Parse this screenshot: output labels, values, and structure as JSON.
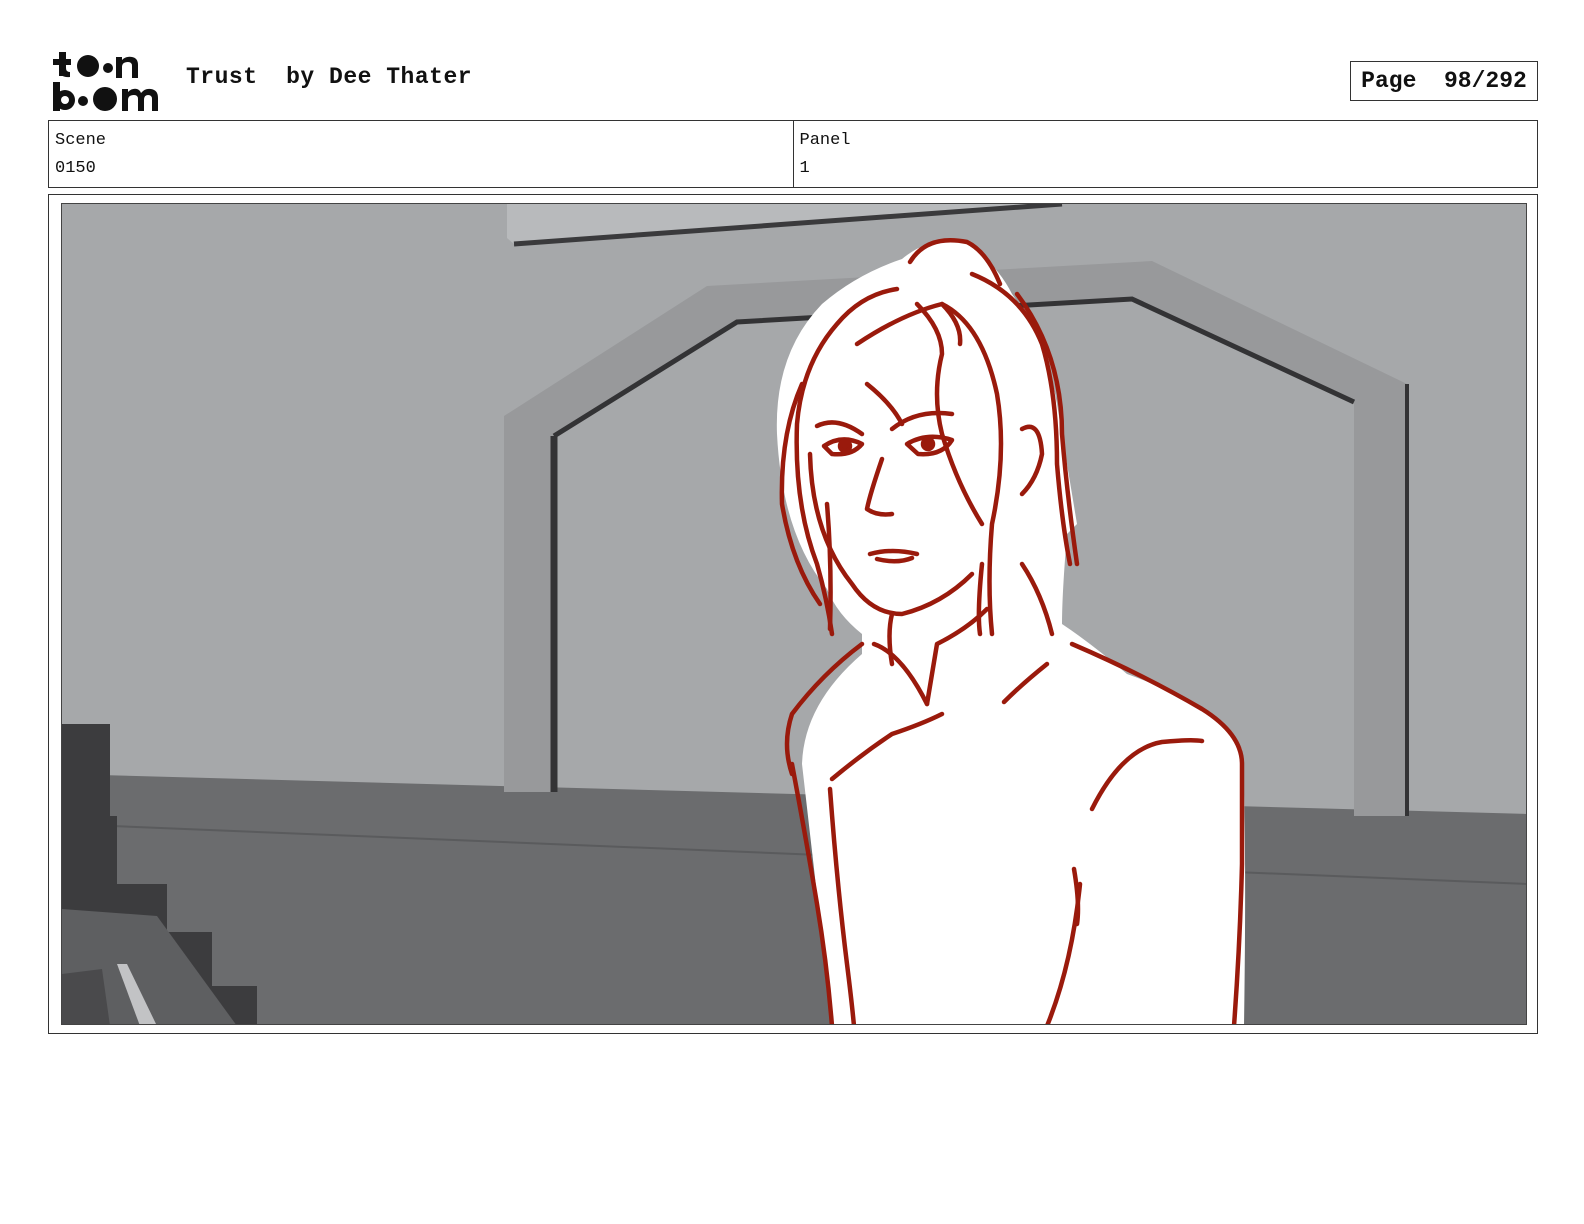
{
  "header": {
    "logo_text": "toonboom",
    "title": "Trust  by Dee Thater",
    "page_label": "Page",
    "page_number": "98/292"
  },
  "info": {
    "scene_label": "Scene",
    "scene_value": "0150",
    "panel_label": "Panel",
    "panel_value": "1"
  },
  "colors": {
    "sketch_line": "#9a1a0c",
    "wall": "#a6a8aa",
    "floor": "#6b6c6e",
    "dark": "#3c3c3e"
  }
}
